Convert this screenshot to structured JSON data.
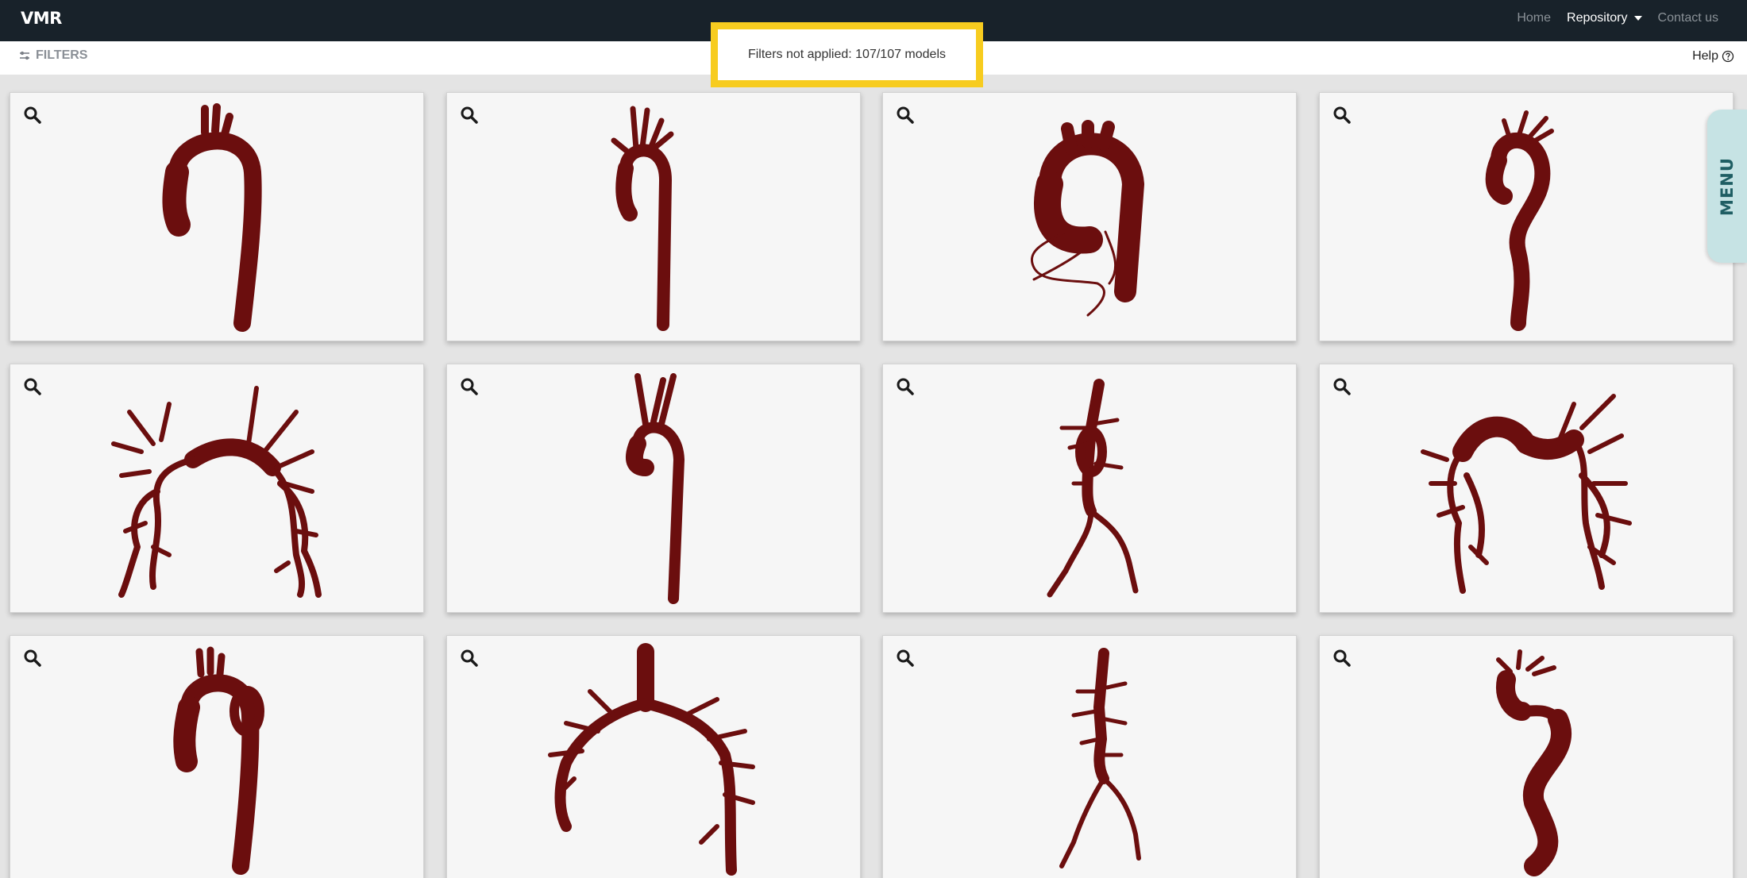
{
  "app": {
    "brand": "VMR"
  },
  "nav": {
    "home": "Home",
    "repository": "Repository",
    "contact": "Contact us"
  },
  "toolbar": {
    "filters_label": "FILTERS",
    "help_label": "Help"
  },
  "status": {
    "text": "Filters not applied: 107/107 models"
  },
  "side_menu": {
    "label": "MENU"
  },
  "colors": {
    "accent": "#f7cc1f",
    "topbar": "#18222a",
    "vessel": "#6b0e0e",
    "menu_tab": "#c6e3e4"
  },
  "grid": {
    "columns": 4,
    "visible_rows": 3,
    "card_icon": "zoom-icon"
  }
}
